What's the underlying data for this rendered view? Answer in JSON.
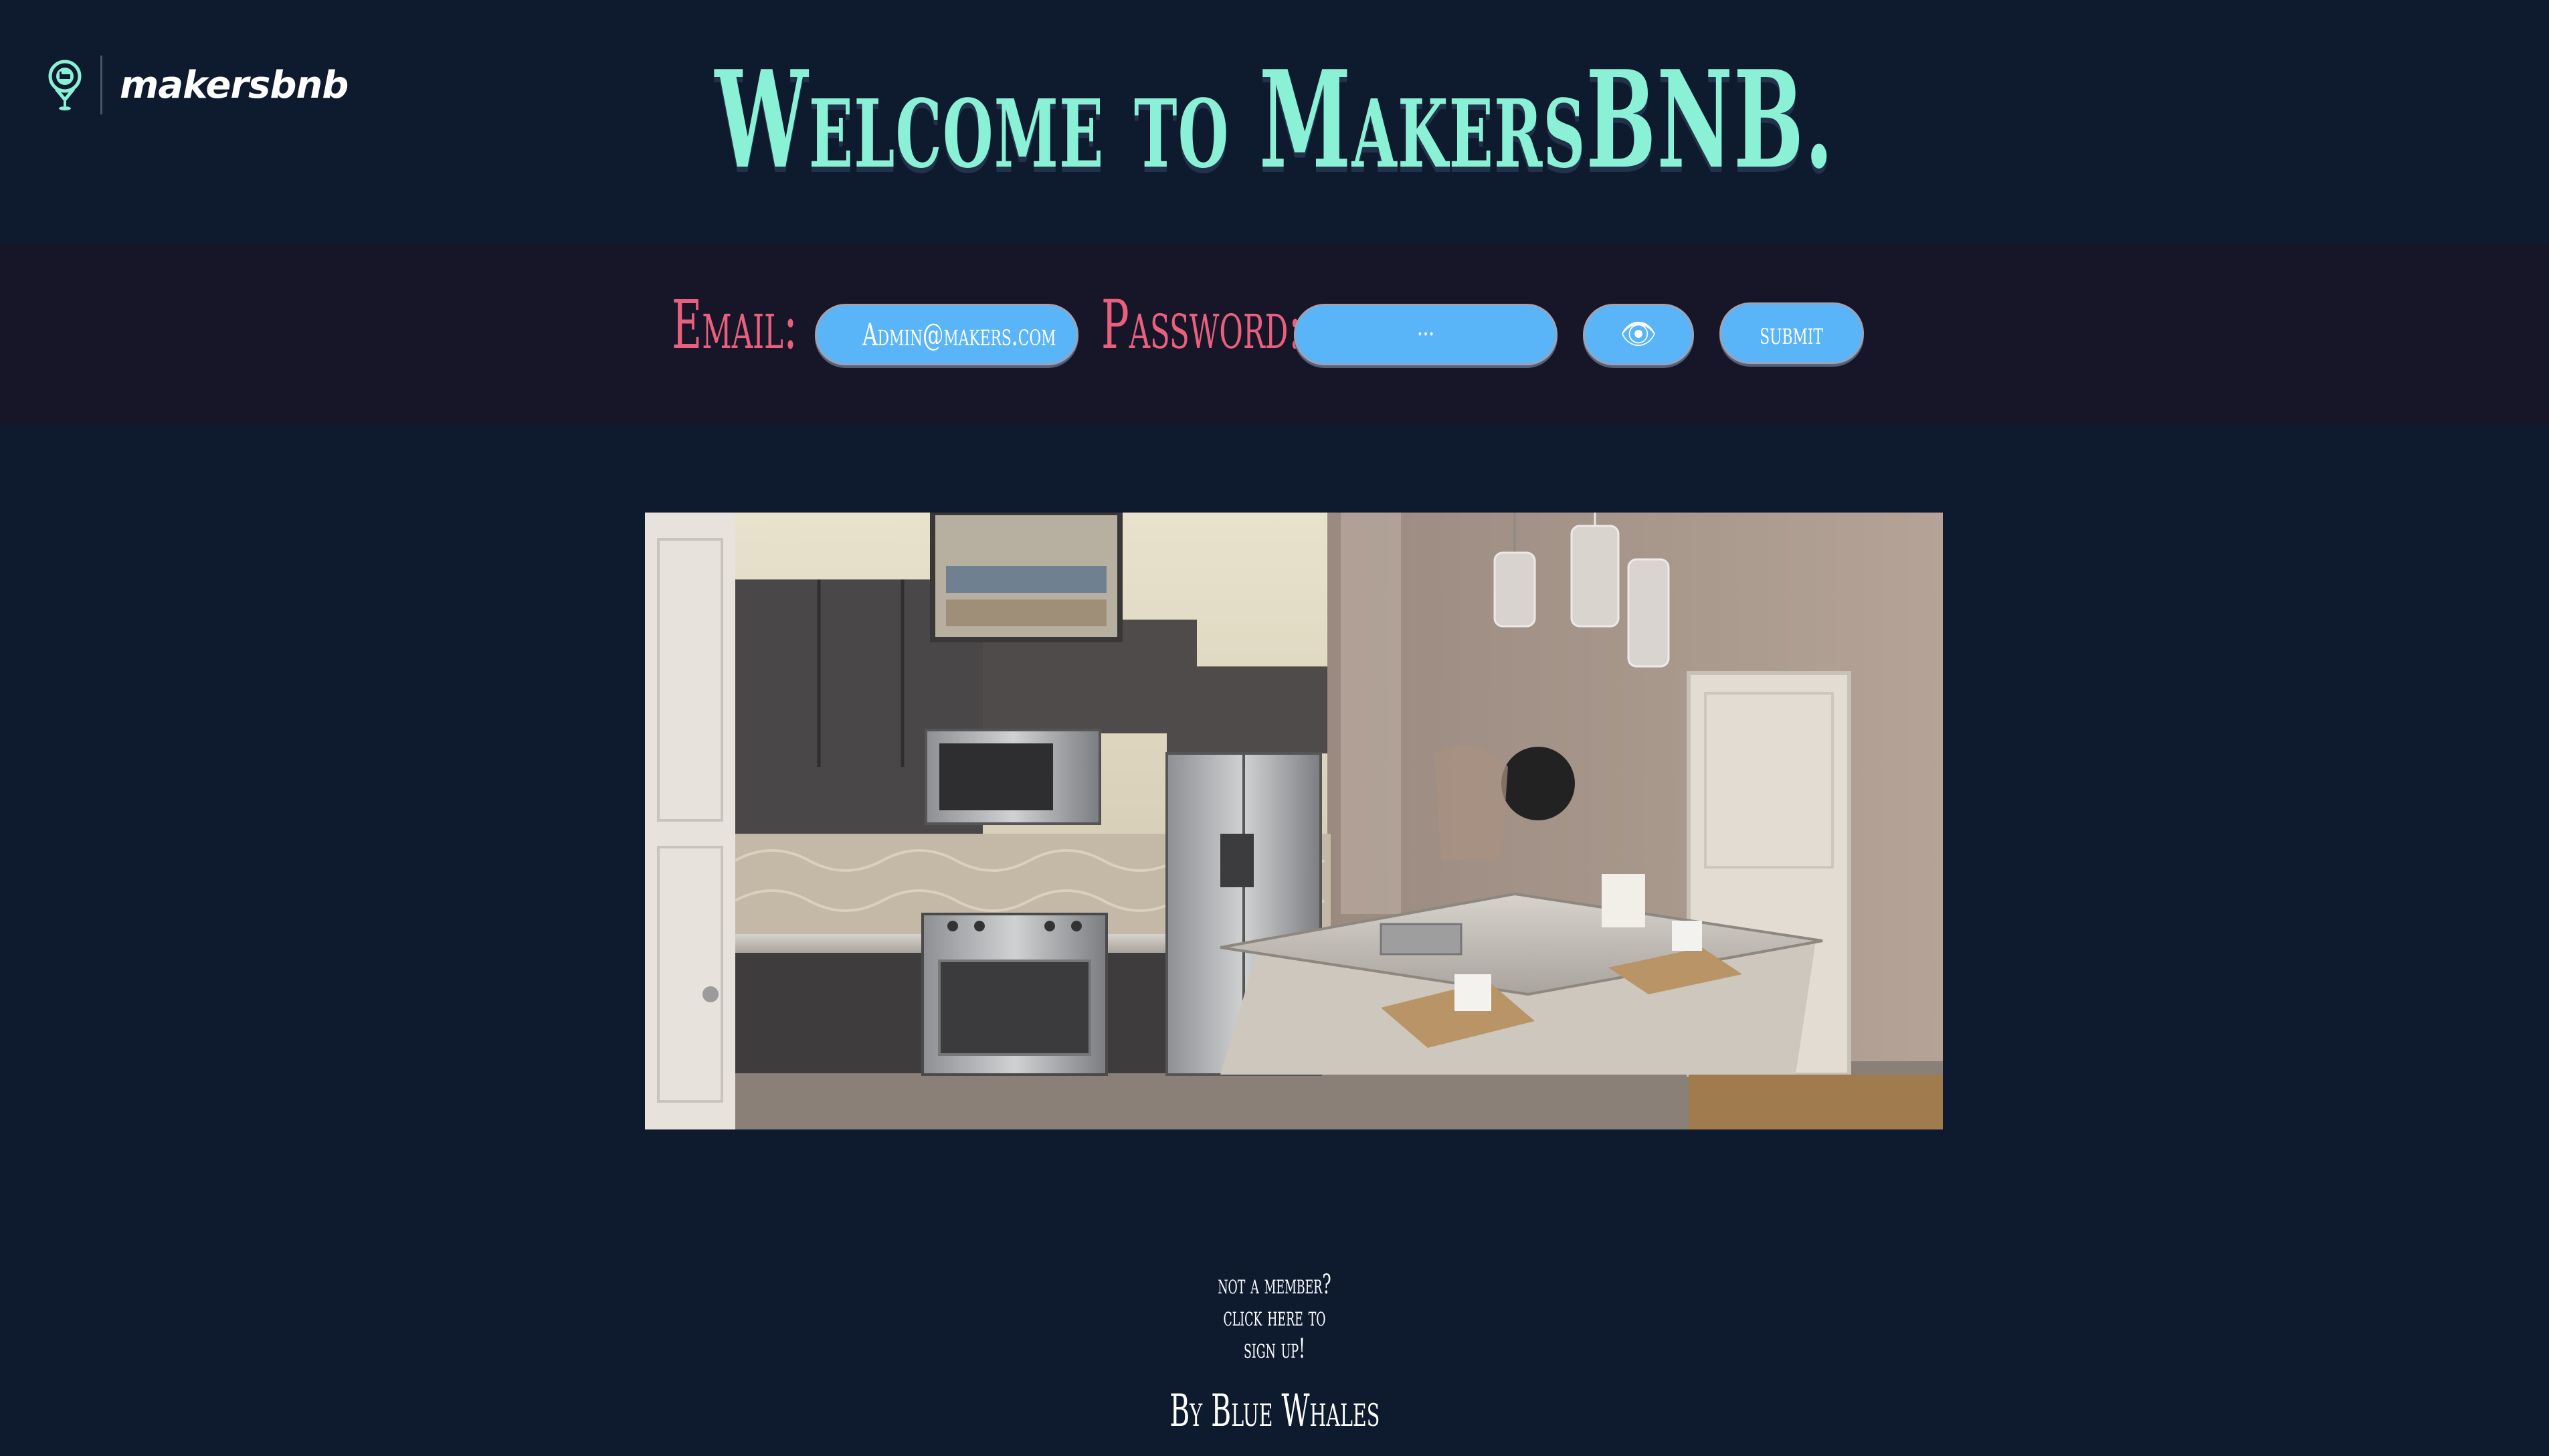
{
  "brand": {
    "name": "makersbnb",
    "accent_color": "#8af0d6",
    "icon": "map-pin-bed-icon"
  },
  "page": {
    "title": "Welcome to MakersBNB.",
    "background_color": "#0e1a2e"
  },
  "login": {
    "email_label": "Email:",
    "email_value": "Admin@makers.com",
    "password_label": "Password:",
    "password_value": "···",
    "show_password_icon": "eye-icon",
    "show_password_glyph": "👁",
    "submit_label": "submit",
    "label_color": "#e8607e",
    "button_color": "#5ab4f8"
  },
  "hero": {
    "icon": "kitchen-photo"
  },
  "footer": {
    "signup_lines": [
      "not a member?",
      "click here to",
      "sign up!"
    ],
    "byline": "By Blue Whales"
  }
}
